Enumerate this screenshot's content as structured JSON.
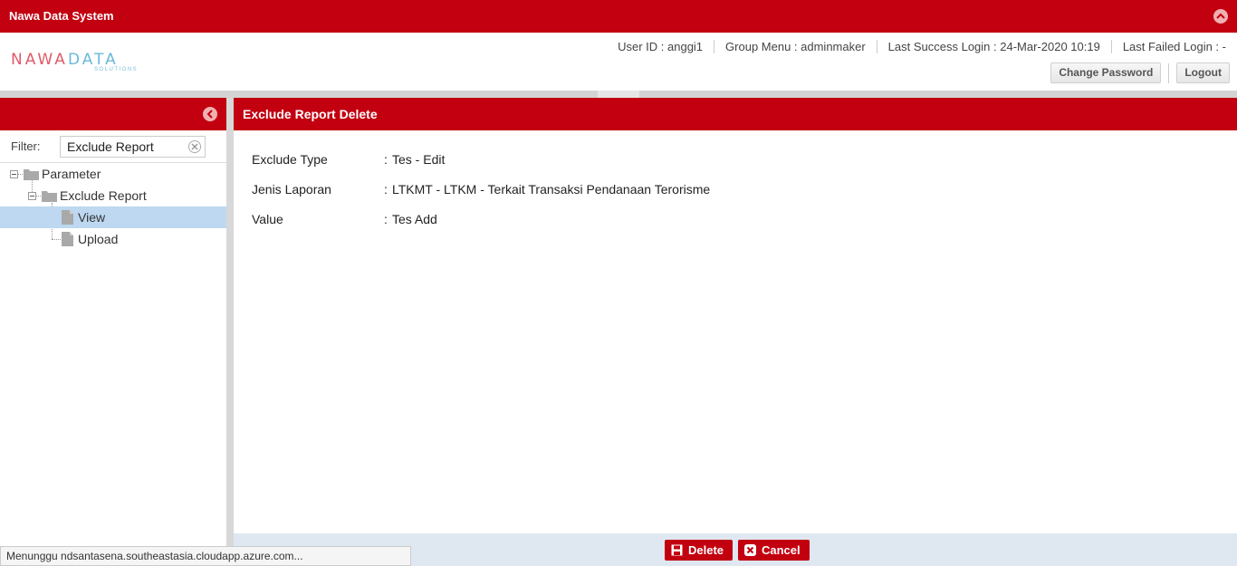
{
  "app": {
    "title": "Nawa Data System"
  },
  "logo": {
    "word_a": "NAWA",
    "word_b": "DATA",
    "sub": "SOLUTIONS"
  },
  "header": {
    "user_id": "User ID : anggi1",
    "group_menu": "Group Menu : adminmaker",
    "last_success": "Last Success Login : 24-Mar-2020 10:19",
    "last_failed": "Last Failed Login : -",
    "change_password": "Change Password",
    "logout": "Logout"
  },
  "sidebar": {
    "filter_label": "Filter:",
    "filter_value": "Exclude Report",
    "tree": [
      {
        "label": "Parameter",
        "level": 0,
        "type": "folder"
      },
      {
        "label": "Exclude Report",
        "level": 1,
        "type": "folder"
      },
      {
        "label": "View",
        "level": 2,
        "type": "page",
        "selected": true
      },
      {
        "label": "Upload",
        "level": 2,
        "type": "page"
      }
    ]
  },
  "main": {
    "title": "Exclude Report Delete",
    "fields": [
      {
        "label": "Exclude Type",
        "value": "Tes - Edit"
      },
      {
        "label": "Jenis Laporan",
        "value": "LTKMT - LTKM - Terkait Transaksi Pendanaan Terorisme"
      },
      {
        "label": "Value",
        "value": "Tes Add"
      }
    ],
    "colon": ":"
  },
  "actions": {
    "delete": "Delete",
    "cancel": "Cancel"
  },
  "statusbar": {
    "text": "Menunggu ndsantasena.southeastasia.cloudapp.azure.com..."
  },
  "colors": {
    "brand_red": "#c20010",
    "selection": "#bdd8f0",
    "footer": "#dfe8f1"
  }
}
